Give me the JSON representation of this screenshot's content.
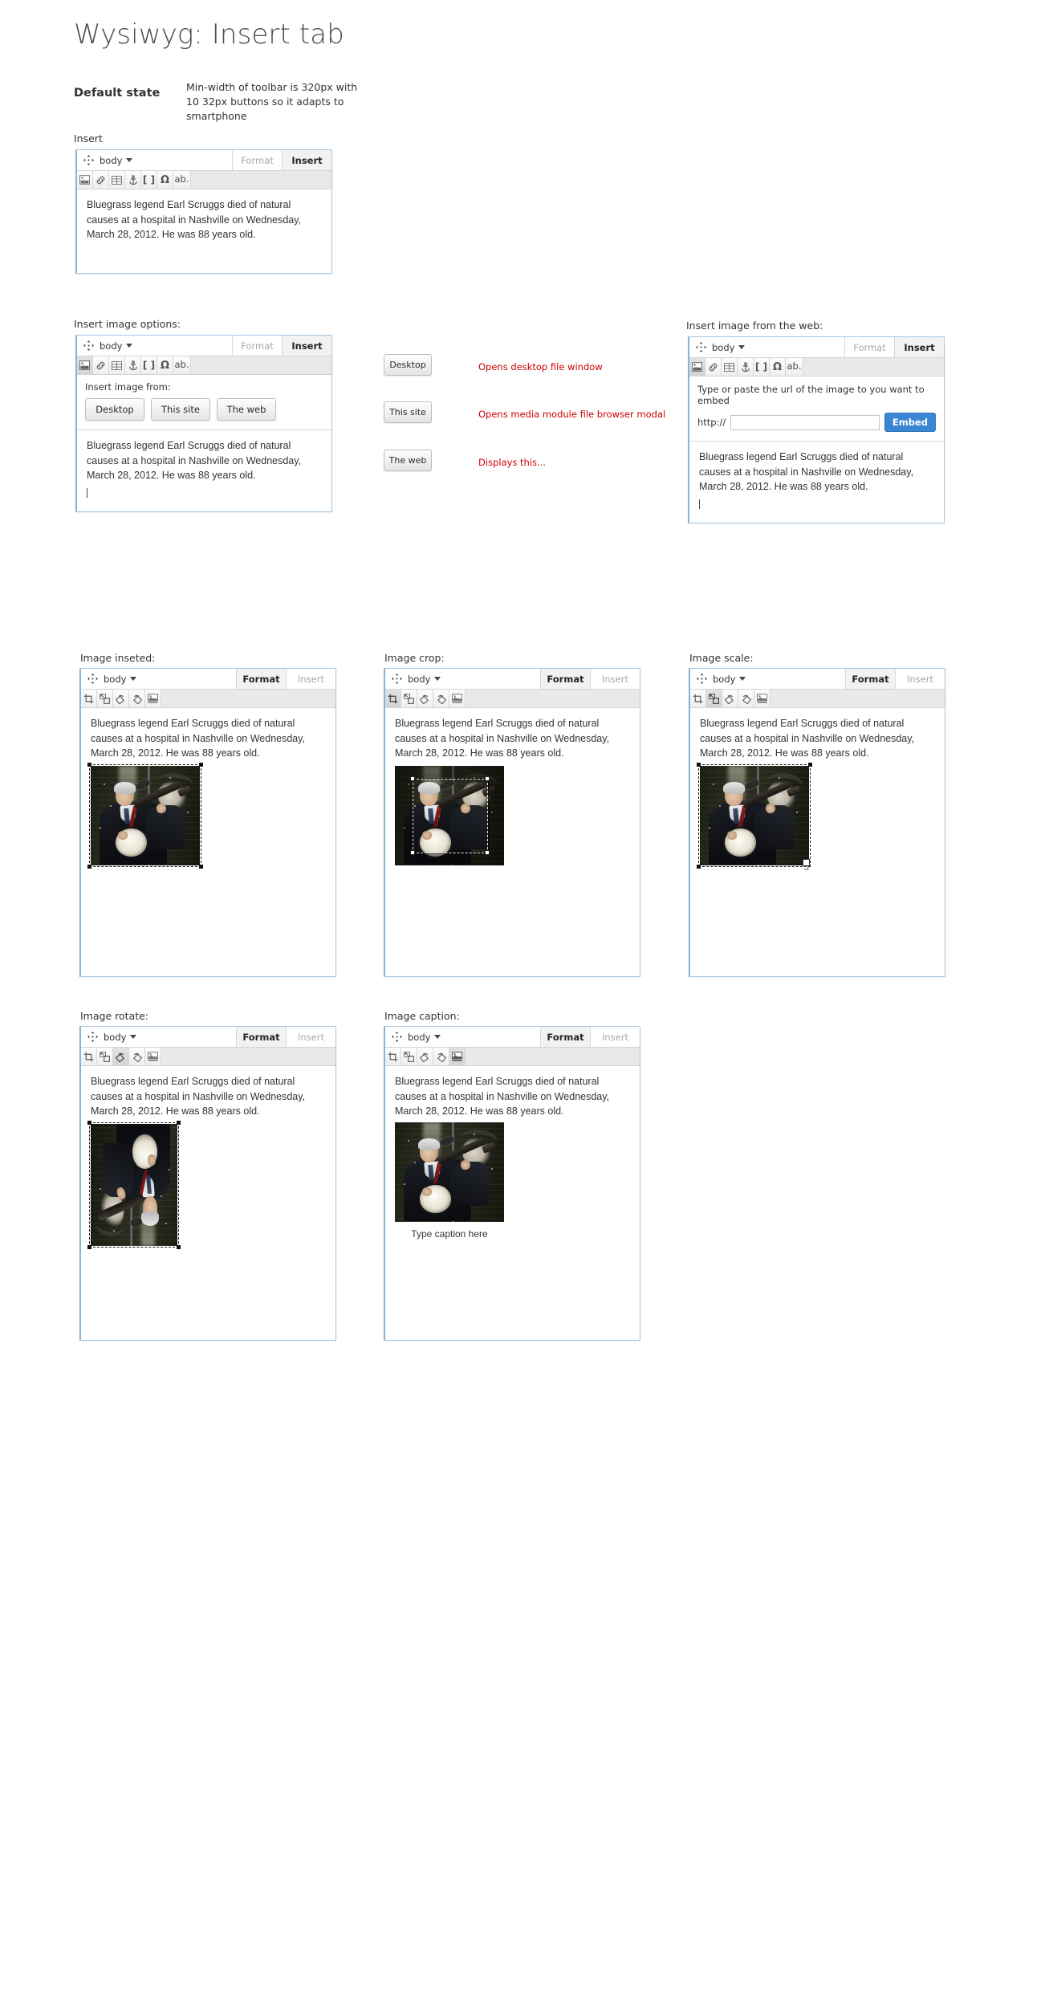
{
  "page": {
    "title": "Wysiwyg: Insert tab",
    "default_state_label": "Default state",
    "note": "Min-width of toolbar is 320px with 10 32px buttons so it adapts to smartphone"
  },
  "body_text": "Bluegrass legend Earl Scruggs died of natural causes at a hospital in Nashville on Wednesday, March 28, 2012. He was 88 years old.",
  "toolbar": {
    "element_selector": "body",
    "tab_format": "Format",
    "tab_insert": "Insert",
    "insert_buttons": [
      {
        "name": "insert-image-icon",
        "glyph": "image"
      },
      {
        "name": "insert-link-icon",
        "glyph": "link"
      },
      {
        "name": "insert-table-icon",
        "glyph": "table"
      },
      {
        "name": "insert-anchor-icon",
        "glyph": "anchor"
      },
      {
        "name": "insert-token-icon",
        "glyph": "[ ]"
      },
      {
        "name": "insert-special-character-icon",
        "glyph": "Ω"
      },
      {
        "name": "insert-abbreviation-icon",
        "glyph": "ab."
      }
    ],
    "format_buttons": [
      {
        "name": "image-crop-icon",
        "glyph": "crop"
      },
      {
        "name": "image-scale-icon",
        "glyph": "scale"
      },
      {
        "name": "image-rotate-left-icon",
        "glyph": "rotate-left"
      },
      {
        "name": "image-rotate-right-icon",
        "glyph": "rotate-right"
      },
      {
        "name": "image-caption-icon",
        "glyph": "caption"
      }
    ]
  },
  "sections": {
    "insert": {
      "label": "Insert"
    },
    "insert_image_options": {
      "label": "Insert image options:",
      "panel_label": "Insert image from:",
      "buttons": [
        "Desktop",
        "This site",
        "The web"
      ]
    },
    "insert_image_web": {
      "label": "Insert image from the web:",
      "instruction": "Type or paste the url of the image to you want to embed",
      "protocol": "http://",
      "url_value": "",
      "url_placeholder": "",
      "embed_label": "Embed"
    },
    "image_inserted": {
      "label": "Image inseted:"
    },
    "image_crop": {
      "label": "Image crop:"
    },
    "image_scale": {
      "label": "Image scale:"
    },
    "image_rotate": {
      "label": "Image rotate:"
    },
    "image_caption": {
      "label": "Image caption:",
      "caption_placeholder": "Type caption here"
    }
  },
  "annotations": [
    {
      "button": "Desktop",
      "text": "Opens desktop file window"
    },
    {
      "button": "This site",
      "text": "Opens media module file browser modal"
    },
    {
      "button": "The web",
      "text": "Displays this..."
    }
  ],
  "colors": {
    "editor_border": "#a9c7e0",
    "accent_blue": "#3b86d3",
    "annotation_red": "#cc0000",
    "toolbar_bg": "#e9e9e9"
  }
}
